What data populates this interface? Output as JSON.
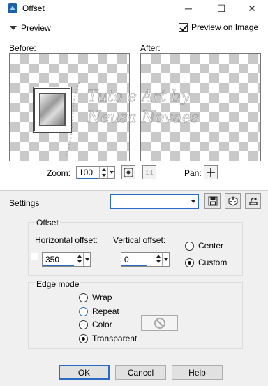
{
  "window": {
    "title": "Offset",
    "minimize_glyph": "─",
    "maximize_glyph": "☐",
    "close_glyph": "✕"
  },
  "preview": {
    "toggle_label": "Preview",
    "preview_on_image_label": "Preview on Image",
    "preview_on_image_checked": true,
    "before_label": "Before:",
    "after_label": "After:",
    "watermark_line1": "Tuto e Art by",
    "watermark_line2": "Neusa Novaes",
    "zoom_label": "Zoom:",
    "zoom_value": "100",
    "fit_button_label": "1:1",
    "pan_label": "Pan:"
  },
  "settings": {
    "label": "Settings",
    "selected_value": ""
  },
  "offset": {
    "title": "Offset",
    "horizontal_label": "Horizontal offset:",
    "horizontal_value": "350",
    "vertical_label": "Vertical offset:",
    "vertical_value": "0",
    "center_label": "Center",
    "custom_label": "Custom",
    "selected": "Custom"
  },
  "edge_mode": {
    "title": "Edge mode",
    "options": [
      "Wrap",
      "Repeat",
      "Color",
      "Transparent"
    ],
    "selected": "Transparent"
  },
  "buttons": {
    "ok": "OK",
    "cancel": "Cancel",
    "help": "Help"
  },
  "colors": {
    "accent": "#2a6cc4",
    "panel_bg": "#f0f0f0",
    "checker": "#c9c9c9"
  }
}
